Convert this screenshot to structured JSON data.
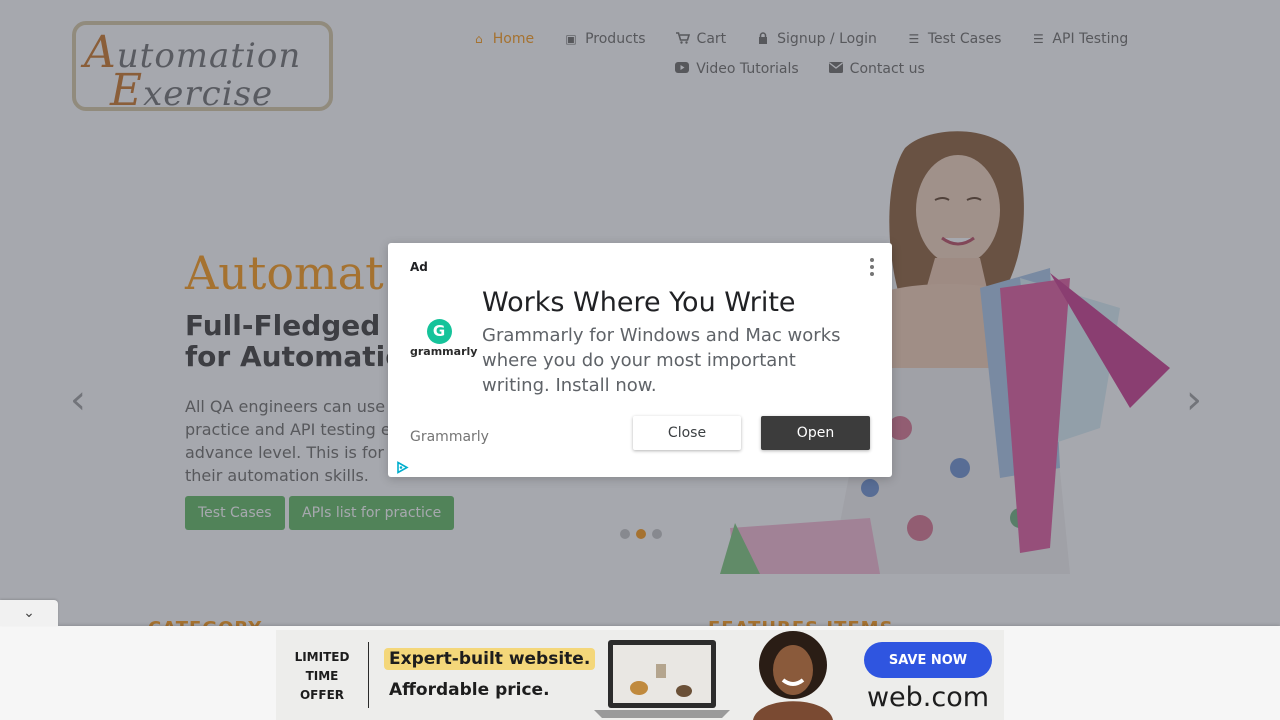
{
  "logo": {
    "line1_cap": "A",
    "line1_rest": "utomation",
    "line2_cap": "E",
    "line2_rest": "xercise"
  },
  "nav": {
    "items": [
      {
        "label": "Home",
        "icon": "home-icon"
      },
      {
        "label": "Products",
        "icon": "briefcase-icon"
      },
      {
        "label": "Cart",
        "icon": "cart-icon"
      },
      {
        "label": "Signup / Login",
        "icon": "lock-icon"
      },
      {
        "label": "Test Cases",
        "icon": "list-icon"
      },
      {
        "label": "API Testing",
        "icon": "list-icon"
      },
      {
        "label": "Video Tutorials",
        "icon": "youtube-icon"
      },
      {
        "label": "Contact us",
        "icon": "envelope-icon"
      }
    ]
  },
  "hero": {
    "title": "Automat",
    "subtitle_line1": "Full-Fledged",
    "subtitle_line2": "for Automatic",
    "desc_line1": "All QA engineers can use",
    "desc_line2": "practice and API testing e",
    "desc_line3": "advance level. This is for",
    "desc_line4": "their automation skills.",
    "btn_test_cases": "Test Cases",
    "btn_apis": "APIs list for practice",
    "prev_arrow": "‹",
    "next_arrow": "›",
    "active_slide": 2
  },
  "sections": {
    "left_title": "CATEGORY",
    "right_title": "FEATURES ITEMS"
  },
  "ad_modal": {
    "ad_label": "Ad",
    "logo_letter": "G",
    "logo_word": "grammarly",
    "headline": "Works Where You Write",
    "body": "Grammarly for Windows and Mac works where you do your most important writing. Install now.",
    "advertiser": "Grammarly",
    "close_label": "Close",
    "open_label": "Open"
  },
  "bottom_ad": {
    "collapse_icon": "⌄",
    "offer_line1": "LIMITED",
    "offer_line2": "TIME",
    "offer_line3": "OFFER",
    "line1": "Expert-built website.",
    "line2": "Affordable price.",
    "cta": "SAVE NOW",
    "brand": "web.com",
    "cta_color": "#2f55e0"
  },
  "colors": {
    "accent": "#fe980f",
    "green": "#5cb85c"
  }
}
